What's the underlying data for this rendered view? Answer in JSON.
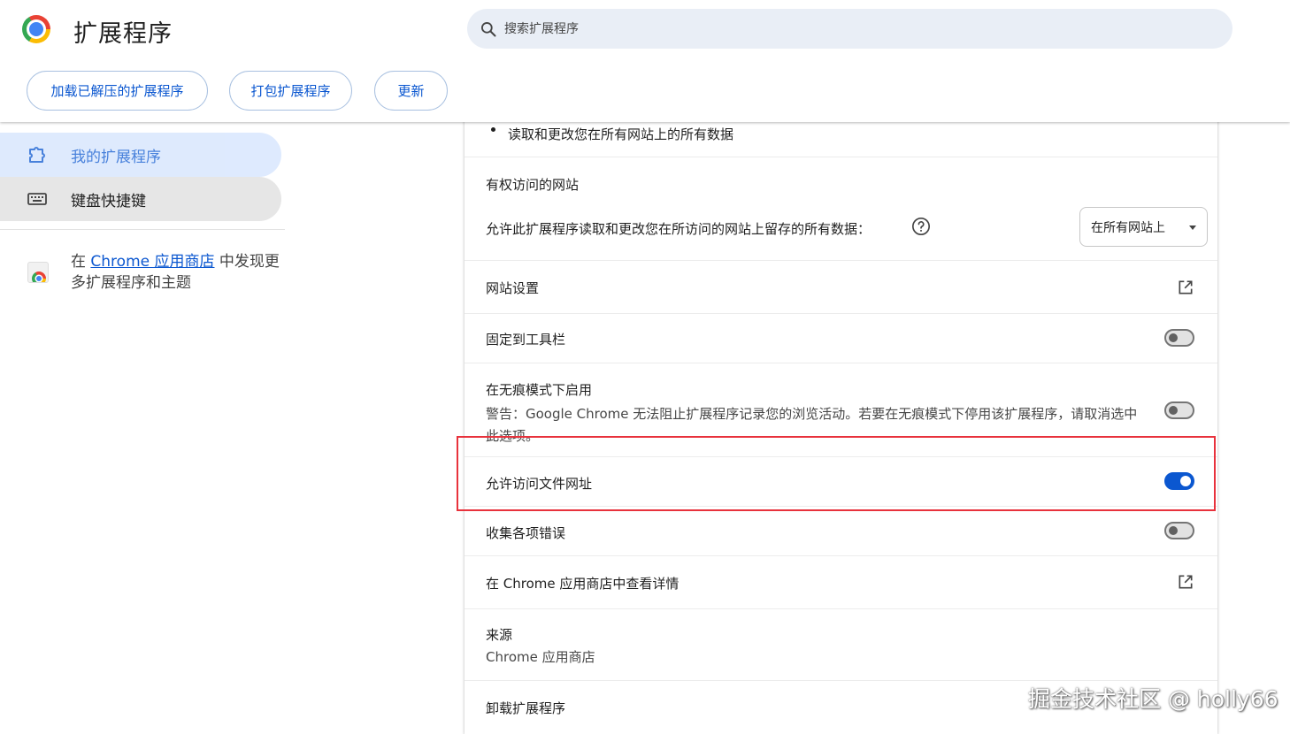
{
  "header": {
    "title": "扩展程序",
    "search_placeholder": "搜索扩展程序",
    "buttons": [
      "加载已解压的扩展程序",
      "打包扩展程序",
      "更新"
    ]
  },
  "sidebar": {
    "items": [
      {
        "label": "我的扩展程序",
        "icon": "puzzle-icon"
      },
      {
        "label": "键盘快捷键",
        "icon": "keyboard-icon"
      }
    ],
    "store_prefix": "在 ",
    "store_link": "Chrome 应用商店",
    "store_suffix": " 中发现更多扩展程序和主题"
  },
  "details": {
    "permission_item": "读取和更改您在所有网站上的所有数据",
    "site_access_title": "有权访问的网站",
    "site_access_desc": "允许此扩展程序读取和更改您在所访问的网站上留存的所有数据：",
    "site_access_value": "在所有网站上",
    "site_settings": "网站设置",
    "pin_toolbar": "固定到工具栏",
    "incognito_title": "在无痕模式下启用",
    "incognito_warning": "警告：Google Chrome 无法阻止扩展程序记录您的浏览活动。若要在无痕模式下停用该扩展程序，请取消选中此选项。",
    "file_urls": "允许访问文件网址",
    "collect_errors": "收集各项错误",
    "view_in_store": "在 Chrome 应用商店中查看详情",
    "source_title": "来源",
    "source_value": "Chrome 应用商店",
    "uninstall": "卸载扩展程序"
  },
  "toggles": {
    "pin_toolbar": false,
    "incognito": false,
    "file_urls": true,
    "collect_errors": false
  },
  "watermark": "掘金技术社区 @ holly66",
  "colors": {
    "accent": "#0b57d0",
    "highlight_box": "#e8323c"
  }
}
